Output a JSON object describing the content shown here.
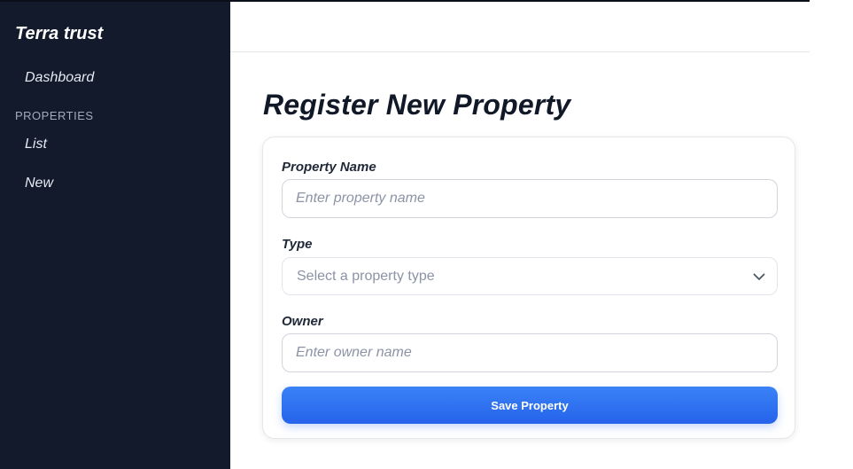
{
  "sidebar": {
    "brand": "Terra trust",
    "items": [
      {
        "label": "Dashboard"
      }
    ],
    "section": {
      "title": "PROPERTIES",
      "items": [
        {
          "label": "List"
        },
        {
          "label": "New"
        }
      ]
    }
  },
  "main": {
    "title": "Register New Property",
    "form": {
      "name": {
        "label": "Property Name",
        "placeholder": "Enter property name",
        "value": ""
      },
      "type": {
        "label": "Type",
        "selected": "Select a property type"
      },
      "owner": {
        "label": "Owner",
        "placeholder": "Enter owner name",
        "value": ""
      },
      "submit_label": "Save Property"
    }
  },
  "icons": {
    "select_chevron": "chevron-down-icon"
  },
  "colors": {
    "sidebar_bg": "#131a2c",
    "primary_button": "#2563eb",
    "text_dark": "#111827"
  }
}
